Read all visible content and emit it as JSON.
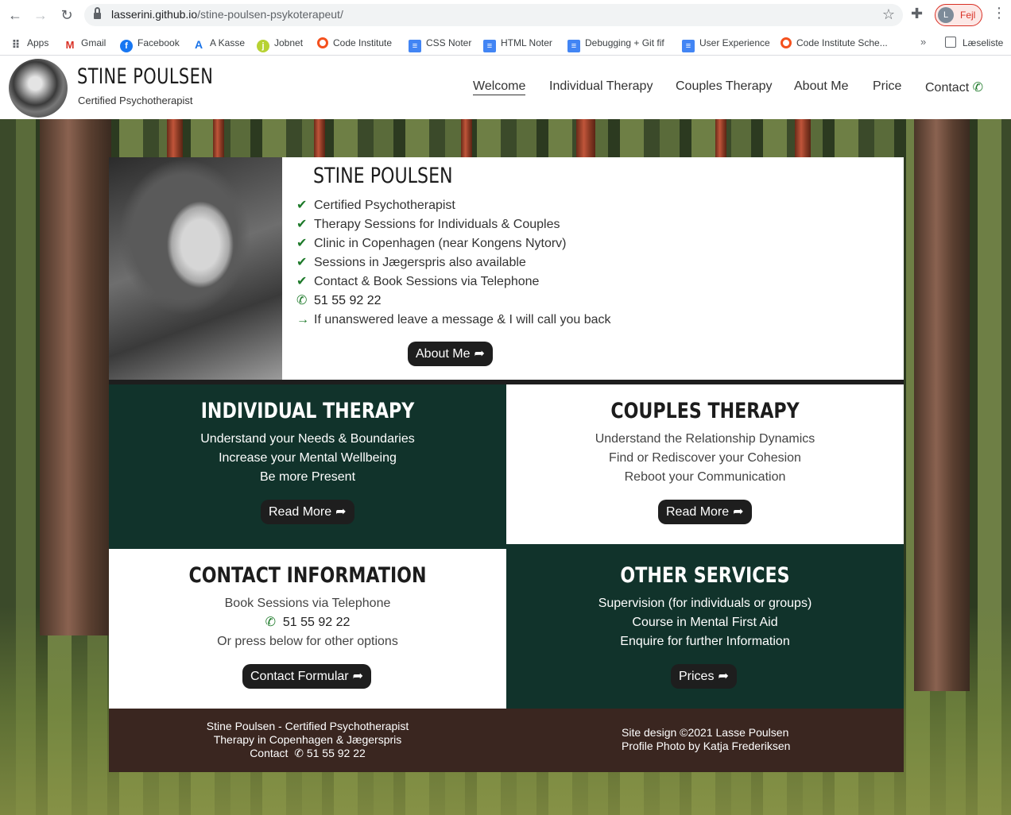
{
  "browser": {
    "url_domain": "lasserini.github.io",
    "url_path": "/stine-poulsen-psykoterapeut/",
    "profile_initial": "L",
    "profile_status": "Fejl",
    "bookmarks": [
      "Apps",
      "Gmail",
      "Facebook",
      "A Kasse",
      "Jobnet",
      "Code Institute",
      "CSS Noter",
      "HTML Noter",
      "Debugging + Git fif",
      "User Experience",
      "Code Institute Sche..."
    ],
    "more_bookmarks": "»",
    "reading_list": "Læseliste"
  },
  "header": {
    "brand_name": "STINE POULSEN",
    "brand_sub": "Certified Psychotherapist",
    "nav": [
      "Welcome",
      "Individual Therapy",
      "Couples Therapy",
      "About Me",
      "Price",
      "Contact"
    ],
    "active_nav": "Welcome"
  },
  "hero": {
    "title": "STINE POULSEN",
    "items": [
      "Certified Psychotherapist",
      "Therapy Sessions for Individuals & Couples",
      "Clinic in Copenhagen (near Kongens Nytorv)",
      "Sessions in Jægerspris also available",
      "Contact & Book Sessions via Telephone"
    ],
    "phone": "51 55 92 22",
    "note": "If unanswered leave a message & I will call you back",
    "button": "About Me"
  },
  "tiles": {
    "individual": {
      "title": "INDIVIDUAL THERAPY",
      "lines": [
        "Understand your Needs & Boundaries",
        "Increase your Mental Wellbeing",
        "Be more Present"
      ],
      "button": "Read More"
    },
    "couples": {
      "title": "COUPLES THERAPY",
      "lines": [
        "Understand the Relationship Dynamics",
        "Find or Rediscover your Cohesion",
        "Reboot your Communication"
      ],
      "button": "Read More"
    },
    "contact": {
      "title": "CONTACT INFORMATION",
      "line1": "Book Sessions via Telephone",
      "phone": "51 55 92 22",
      "line3": "Or press below for other options",
      "button": "Contact Formular"
    },
    "other": {
      "title": "OTHER SERVICES",
      "lines": [
        "Supervision (for individuals or groups)",
        "Course in Mental First Aid",
        "Enquire for further Information"
      ],
      "button": "Prices"
    }
  },
  "footer": {
    "left_line1": "Stine Poulsen - Certified Psychotherapist",
    "left_line2": "Therapy in Copenhagen & Jægerspris",
    "left_contact": "Contact",
    "left_phone": "51 55 92 22",
    "right_line1": "Site design ©2021 Lasse Poulsen",
    "right_line2": "Profile Photo by Katja Frederiksen"
  },
  "colors": {
    "dark_green": "#11332b",
    "button_dark": "#1e1e1e",
    "footer_brown": "#3a2620",
    "check_green": "#1e7a2a"
  }
}
